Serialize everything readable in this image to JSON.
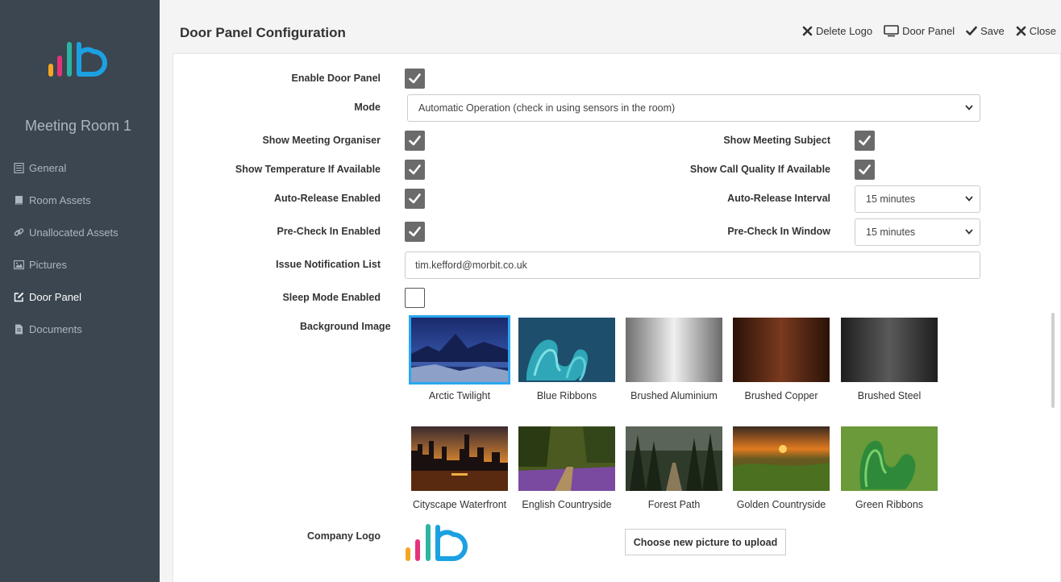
{
  "sidebar": {
    "room_title": "Meeting Room 1",
    "items": [
      {
        "label": "General",
        "icon": "list-icon"
      },
      {
        "label": "Room Assets",
        "icon": "book-icon"
      },
      {
        "label": "Unallocated Assets",
        "icon": "link-icon"
      },
      {
        "label": "Pictures",
        "icon": "image-icon"
      },
      {
        "label": "Door Panel",
        "icon": "edit-icon",
        "active": true
      },
      {
        "label": "Documents",
        "icon": "file-icon"
      }
    ]
  },
  "header": {
    "title": "Door Panel Configuration",
    "actions": {
      "delete_logo": "Delete Logo",
      "door_panel": "Door Panel",
      "save": "Save",
      "close": "Close"
    }
  },
  "form": {
    "enable_door_panel": {
      "label": "Enable Door Panel",
      "checked": true
    },
    "mode": {
      "label": "Mode",
      "value": "Automatic Operation (check in using sensors in the room)"
    },
    "show_organiser": {
      "label": "Show Meeting Organiser",
      "checked": true
    },
    "show_subject": {
      "label": "Show Meeting Subject",
      "checked": true
    },
    "show_temperature": {
      "label": "Show Temperature If Available",
      "checked": true
    },
    "show_call_quality": {
      "label": "Show Call Quality If Available",
      "checked": true
    },
    "auto_release_enabled": {
      "label": "Auto-Release Enabled",
      "checked": true
    },
    "auto_release_interval": {
      "label": "Auto-Release Interval",
      "value": "15 minutes"
    },
    "precheck_enabled": {
      "label": "Pre-Check In Enabled",
      "checked": true
    },
    "precheck_window": {
      "label": "Pre-Check In Window",
      "value": "15 minutes"
    },
    "notification_list": {
      "label": "Issue Notification List",
      "value": "tim.kefford@morbit.co.uk"
    },
    "sleep_mode": {
      "label": "Sleep Mode Enabled",
      "checked": false
    },
    "background_image": {
      "label": "Background Image",
      "selected": "Arctic Twilight",
      "images": [
        "Arctic Twilight",
        "Blue Ribbons",
        "Brushed Aluminium",
        "Brushed Copper",
        "Brushed Steel",
        "Cityscape Waterfront",
        "English Countryside",
        "Forest Path",
        "Golden Countryside",
        "Green Ribbons"
      ]
    },
    "company_logo": {
      "label": "Company Logo",
      "upload_label": "Choose new picture to upload"
    }
  },
  "colors": {
    "sidebar_bg": "#3b4650",
    "checkbox_fill": "#6b6b6b",
    "selected_outline": "#2aa7f0",
    "logo_orange": "#f5a623",
    "logo_pink": "#e5337a",
    "logo_teal": "#2bb5a3",
    "logo_blue": "#1ba1e2"
  }
}
